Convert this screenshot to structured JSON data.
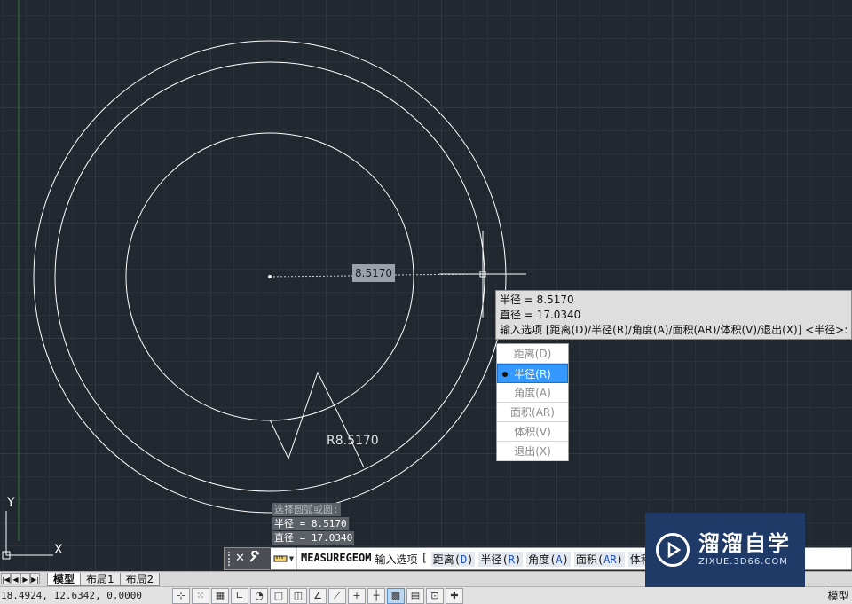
{
  "canvas": {
    "dimension_value": "8.5170",
    "radius_label": "R8.5170"
  },
  "tooltip": {
    "radius_line": "半径 = 8.5170",
    "diameter_line": "直径 = 17.0340",
    "prompt_line": "输入选项 [距离(D)/半径(R)/角度(A)/面积(AR)/体积(V)/退出(X)] <半径>:"
  },
  "menu": {
    "items": [
      {
        "label": "距离(D)"
      },
      {
        "label": "半径(R)",
        "selected": true
      },
      {
        "label": "角度(A)"
      },
      {
        "label": "面积(AR)"
      },
      {
        "label": "体积(V)"
      },
      {
        "label": "退出(X)"
      }
    ]
  },
  "history": {
    "lines": [
      "选择圆弧或圆:",
      "半径 = 8.5170",
      "直径 = 17.0340"
    ]
  },
  "command_line": {
    "command": "MEASUREGEOM",
    "prompt": "输入选项",
    "options": [
      {
        "label": "距离",
        "key": "D"
      },
      {
        "label": "半径",
        "key": "R"
      },
      {
        "label": "角度",
        "key": "A"
      },
      {
        "label": "面积",
        "key": "AR"
      },
      {
        "label": "体积",
        "key": "V"
      }
    ],
    "open_bracket": "[",
    "close_icon": "close-icon",
    "customize_icon": "wrench-icon"
  },
  "tabs": {
    "nav": [
      "|◀",
      "◀",
      "▶",
      "▶|"
    ],
    "items": [
      {
        "label": "模型",
        "active": true
      },
      {
        "label": "布局1"
      },
      {
        "label": "布局2"
      }
    ]
  },
  "status": {
    "coordinates": "18.4924, 12.6342, 0.0000",
    "model_label": "模型",
    "tool_icons": [
      "infer-icon",
      "snap-icon",
      "grid-icon",
      "ortho-icon",
      "polar-icon",
      "osnap-icon",
      "3dosnap-icon",
      "otrack-icon",
      "ducs-icon",
      "dyn-icon",
      "lineweight-icon",
      "transparency-icon",
      "qp-icon",
      "sc-icon",
      "am-icon"
    ]
  },
  "watermark": {
    "title": "溜溜自学",
    "url": "ZIXUE.3D66.COM"
  },
  "colors": {
    "canvas_bg": "#212830",
    "grid_major": "#2f3845",
    "grid_minor": "#29313b",
    "selection_blue": "#3399ff",
    "watermark_bg": "#1f3a66"
  }
}
